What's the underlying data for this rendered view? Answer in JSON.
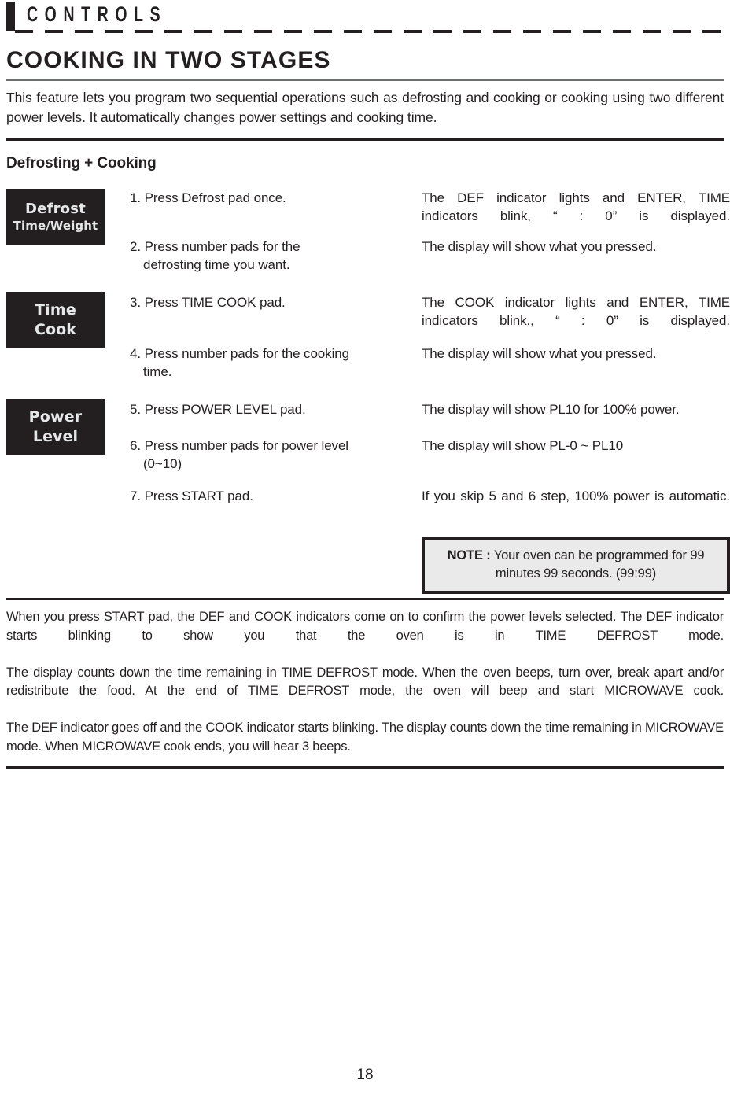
{
  "running_head": {
    "label": "CONTROLS"
  },
  "section": {
    "title": "COOKING IN TWO STAGES",
    "intro": "This feature lets you program two sequential operations such as defrosting and cooking or cooking using two different power levels. It automatically changes power settings and cooking time.",
    "subsection_title": "Defrosting + Cooking"
  },
  "pads": [
    {
      "name": "defrost-pad",
      "line1": "Defrost",
      "line2": "Time/Weight"
    },
    {
      "name": "time-cook-pad",
      "line1": "Time",
      "line2": "Cook"
    },
    {
      "name": "power-level-pad",
      "line1": "Power",
      "line2": "Level"
    }
  ],
  "steps": [
    {
      "number": "1.",
      "text": "Press Defrost pad once.",
      "continuation": "",
      "result": "The DEF indicator lights and ENTER, TIME indicators blink, “ : 0” is displayed.",
      "justified": true
    },
    {
      "number": "2.",
      "text": "Press number pads for the",
      "continuation": "defrosting time you want.",
      "result": "The display will show what you pressed.",
      "justified": false
    },
    {
      "number": "3.",
      "text": "Press TIME COOK pad.",
      "continuation": "",
      "result": "The COOK indicator lights and ENTER, TIME indicators blink., “ : 0” is displayed.",
      "justified": true
    },
    {
      "number": "4.",
      "text": "Press number pads for the cooking",
      "continuation": "time.",
      "result": "The display will show what you pressed.",
      "justified": false
    },
    {
      "number": "5.",
      "text": "Press POWER LEVEL pad.",
      "continuation": "",
      "result": "The display will show PL10 for 100% power.",
      "justified": false
    },
    {
      "number": "6.",
      "text": "Press number pads for power level",
      "continuation": "(0~10)",
      "result": "The display will show PL-0 ~ PL10",
      "justified": false
    },
    {
      "number": "7.",
      "text": "Press START pad.",
      "continuation": "",
      "result": "If you skip 5 and 6 step, 100% power is automatic.",
      "justified": true
    }
  ],
  "note": {
    "label": "NOTE :",
    "line1": "Your oven can be programmed for 99",
    "line2": "minutes 99 seconds. (99:99)"
  },
  "closing": {
    "paragraph1": "When you press START pad, the DEF and COOK indicators come on to confirm the power levels selected. The DEF indicator starts blinking to show you that the oven is in TIME DEFROST mode.",
    "paragraph2": "The display counts down the time remaining in TIME DEFROST mode. When the oven beeps, turn over, break apart and/or redistribute the food. At the end of TIME DEFROST mode, the oven will beep and start MICROWAVE cook.",
    "paragraph3": "The DEF indicator goes off and the COOK indicator starts blinking. The display counts down the time remaining in MICROWAVE mode. When MICROWAVE cook ends, you will hear 3 beeps."
  },
  "folio": {
    "page_number": "18"
  },
  "colors": {
    "ink": "#231f20",
    "pad_background": "#231f20",
    "pad_text": "#e6e7e8",
    "note_background": "#eaeaea",
    "thin_rule": "#6d6e71"
  }
}
